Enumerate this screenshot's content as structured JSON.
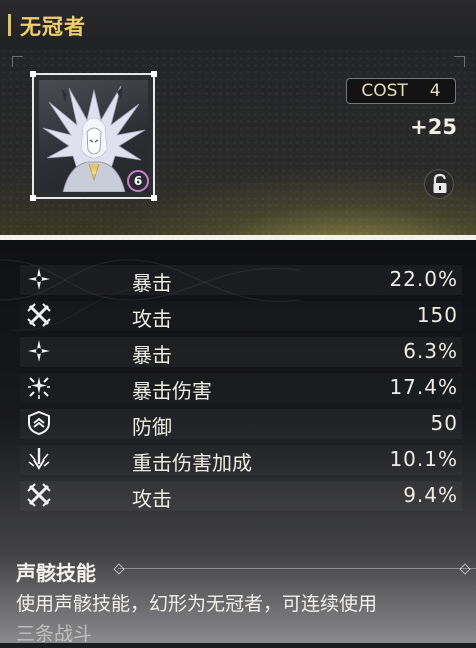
{
  "header": {
    "title": "无冠者"
  },
  "echo": {
    "cost_label": "COST",
    "cost_value": "4",
    "level": "+25",
    "rank_badge": "6",
    "lock_icon": "unlock-icon"
  },
  "stats": [
    {
      "icon": "crit-rate-icon",
      "label": "暴击",
      "value": "22.0%"
    },
    {
      "icon": "attack-icon",
      "label": "攻击",
      "value": "150"
    },
    {
      "icon": "crit-rate-icon",
      "label": "暴击",
      "value": "6.3%"
    },
    {
      "icon": "crit-damage-icon",
      "label": "暴击伤害",
      "value": "17.4%"
    },
    {
      "icon": "defense-icon",
      "label": "防御",
      "value": "50"
    },
    {
      "icon": "heavy-attack-bonus-icon",
      "label": "重击伤害加成",
      "value": "10.1%"
    },
    {
      "icon": "attack-icon",
      "label": "攻击",
      "value": "9.4%"
    }
  ],
  "skill": {
    "title": "声骸技能",
    "description_line1": "使用声骸技能，幻形为无冠者，可连续使用",
    "description_line2": "三条战斗"
  },
  "colors": {
    "title_gold": "#f0cf6a",
    "glow": "#e2d46e",
    "rank_ring": "#c77fc9"
  }
}
